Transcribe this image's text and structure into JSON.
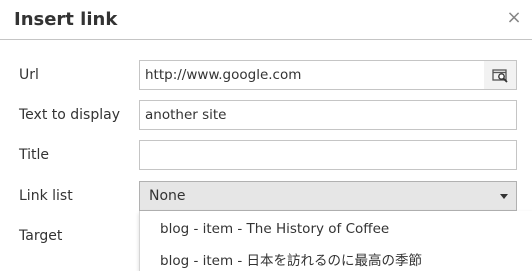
{
  "dialog": {
    "title": "Insert link",
    "close_icon": "×"
  },
  "form": {
    "url": {
      "label": "Url",
      "value": "http://www.google.com"
    },
    "text_to_display": {
      "label": "Text to display",
      "value": "another site"
    },
    "title": {
      "label": "Title",
      "value": ""
    },
    "link_list": {
      "label": "Link list",
      "selected": "None"
    },
    "target": {
      "label": "Target"
    }
  },
  "link_list_options": [
    "blog - item - The History of Coffee",
    "blog - item - 日本を訪れるのに最高の季節"
  ],
  "icons": {
    "browse": "browse-icon",
    "close": "close-icon",
    "dropdown": "caret-down-icon"
  }
}
